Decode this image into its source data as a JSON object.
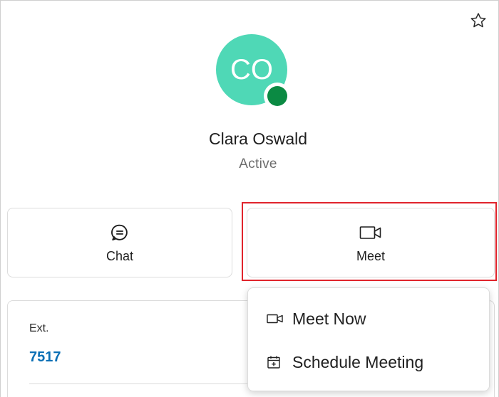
{
  "contact": {
    "initials": "CO",
    "name": "Clara Oswald",
    "status": "Active"
  },
  "actions": {
    "chat_label": "Chat",
    "meet_label": "Meet"
  },
  "details": {
    "ext_label": "Ext.",
    "ext_value": "7517"
  },
  "meet_menu": {
    "items": [
      {
        "label": "Meet Now",
        "icon": "video-camera-icon"
      },
      {
        "label": "Schedule Meeting",
        "icon": "calendar-add-icon"
      }
    ]
  },
  "colors": {
    "avatar_bg": "#4fd8b6",
    "presence_active": "#0b8a43",
    "link": "#0a6fb5",
    "highlight": "#e0242c"
  },
  "icons": {
    "favorite": "star-outline-icon",
    "chat": "chat-bubble-icon",
    "meet": "video-camera-icon"
  }
}
